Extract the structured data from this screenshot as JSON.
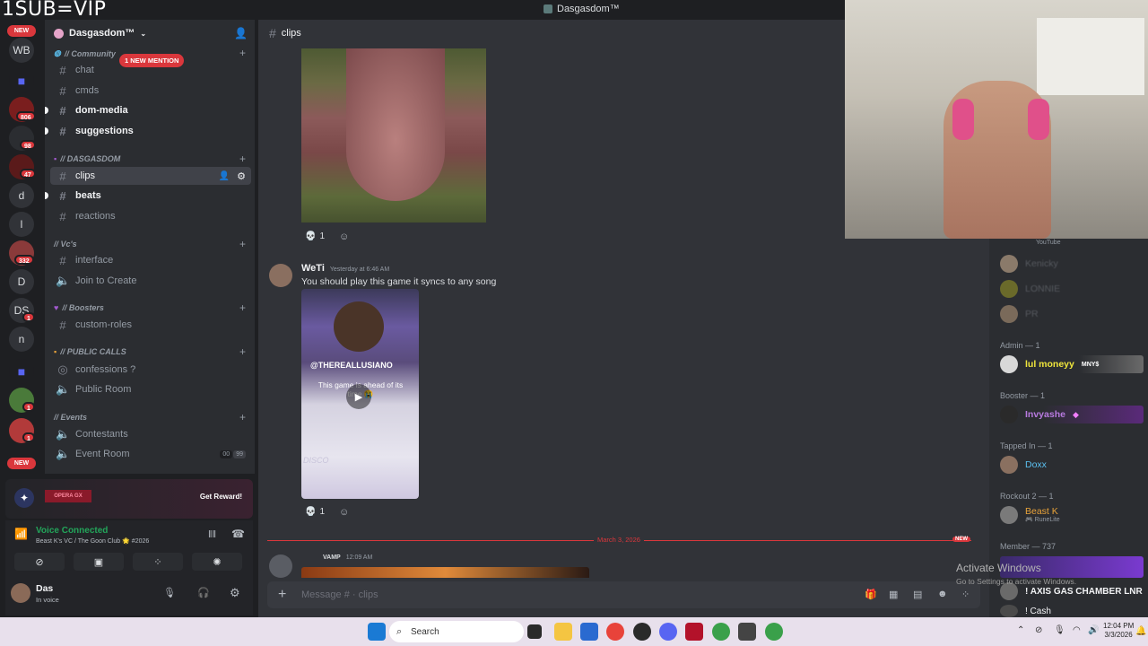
{
  "overlay_text": "1SUB=VIP",
  "window": {
    "title": "Dasgasdom™"
  },
  "rail": {
    "new_top": "NEW",
    "new_bottom": "NEW",
    "labels": {
      "wb": "WB",
      "d": "d",
      "l": "l",
      "D": "D",
      "ds": "DS",
      "n": "n"
    },
    "badges": {
      "b806": "806",
      "b98": "98",
      "b47": "47",
      "b332": "332",
      "ds1": "1",
      "b1a": "1",
      "b1b": "1"
    }
  },
  "guild": {
    "name": "Dasgasdom™"
  },
  "categories": {
    "community": "// Community",
    "dasgasdom": "// DASGASDOM",
    "vcs": "// Vc's",
    "boosters": "// Boosters",
    "public_calls": "// PUBLIC CALLS",
    "events": "// Events"
  },
  "mention_pill": "1 NEW MENTION",
  "channels": {
    "chat": "chat",
    "cmds": "cmds",
    "dom_media": "dom-media",
    "suggestions": "suggestions",
    "clips": "clips",
    "beats": "beats",
    "reactions": "reactions",
    "interface": "interface",
    "join_to_create": "Join to Create",
    "custom_roles": "custom-roles",
    "confessions": "confessions ?",
    "public_room": "Public Room",
    "contestants": "Contestants",
    "event_room": "Event Room",
    "event_room_a": "00",
    "event_room_b": "99"
  },
  "promo": {
    "brand": "OPERA GX",
    "button": "Get Reward!"
  },
  "voice": {
    "status": "Voice Connected",
    "location": "Beast K's VC / The Goon Club 🌟 #2026"
  },
  "user": {
    "name": "Das",
    "status": "In voice"
  },
  "main": {
    "channel": "clips",
    "reaction_count_1": "1",
    "reaction_count_2": "1",
    "msg2": {
      "author": "WeTi",
      "time": "Yesterday at 6:46 AM",
      "text": "You should play this game it syncs to any song"
    },
    "video": {
      "handle": "@THEREALLUSIANO",
      "caption": "This game is ahead of its time 😭",
      "disco": "DISCO"
    },
    "divider_date": "March 3, 2026",
    "divider_new": "NEW",
    "msg3": {
      "tag": "VAMP",
      "time": "12:09 AM"
    },
    "composer_placeholder": "Message # · clips"
  },
  "members": {
    "top_tag": "YouTube",
    "top_names": [
      "Kenicky",
      "LONNIE",
      "PR"
    ],
    "roles": {
      "admin": "Admin — 1",
      "booster": "Booster — 1",
      "tapped": "Tapped In — 1",
      "rockout": "Rockout 2 — 1",
      "member": "Member — 737"
    },
    "admin_name": "lul moneyy",
    "admin_tag": "MNY$",
    "booster_name": "Invyashe",
    "tapped_name": "Doxx",
    "rockout_name": "Beast K",
    "rockout_sub": "RuneLite",
    "member_1": "! AXIS GAS CHAMBER LNR",
    "member_2": "! Cash",
    "colors": {
      "admin": "#f0e63c",
      "tapped": "#5bc0f0",
      "rockout": "#e8a33a"
    }
  },
  "watermark": {
    "line1": "Activate Windows",
    "line2": "Go to Settings to activate Windows."
  },
  "taskbar": {
    "search": "Search",
    "time": "12:04 PM",
    "date": "3/3/2026"
  }
}
